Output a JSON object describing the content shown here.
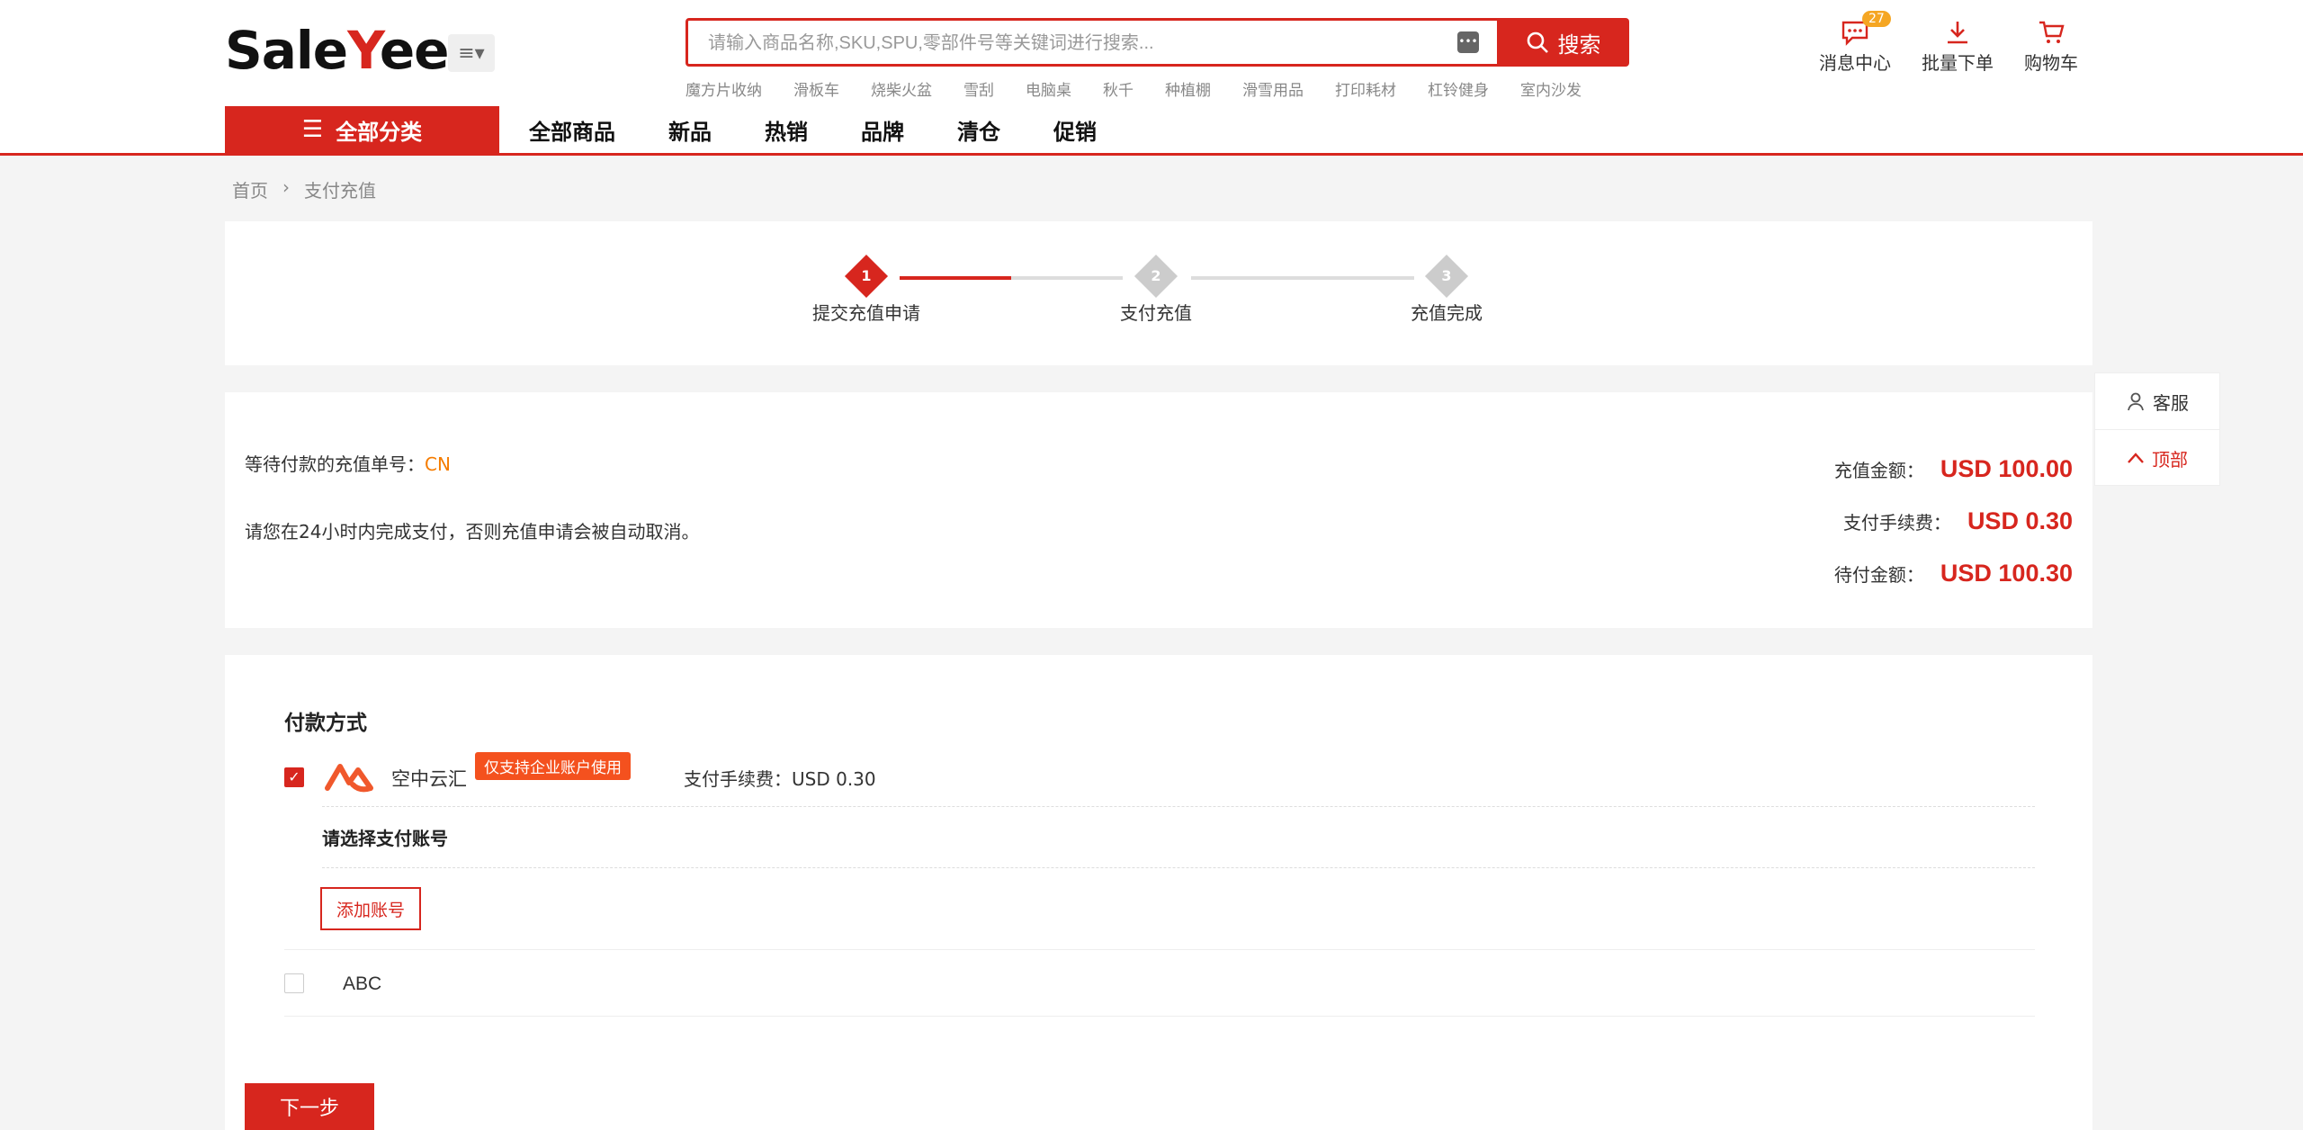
{
  "brand": {
    "logo_part1": "Sale",
    "logo_part2": "Y",
    "logo_part3": "ee",
    "accent_color": "#d7261e"
  },
  "search": {
    "placeholder": "请输入商品名称,SKU,SPU,零部件号等关键词进行搜索...",
    "button_label": "搜索",
    "hot_words": [
      "魔方片收纳",
      "滑板车",
      "烧柴火盆",
      "雪刮",
      "电脑桌",
      "秋千",
      "种植棚",
      "滑雪用品",
      "打印耗材",
      "杠铃健身",
      "室内沙发"
    ]
  },
  "top_icons": {
    "messages": {
      "label": "消息中心",
      "badge": "27"
    },
    "bulk_order": {
      "label": "批量下单"
    },
    "cart": {
      "label": "购物车"
    }
  },
  "nav": {
    "all_categories": "全部分类",
    "links": [
      "全部商品",
      "新品",
      "热销",
      "品牌",
      "清仓",
      "促销"
    ]
  },
  "breadcrumb": {
    "home": "首页",
    "separator": "›",
    "current": "支付充值"
  },
  "steps": [
    {
      "num": "1",
      "label": "提交充值申请",
      "state": "active"
    },
    {
      "num": "2",
      "label": "支付充值",
      "state": "inactive"
    },
    {
      "num": "3",
      "label": "充值完成",
      "state": "inactive"
    }
  ],
  "order": {
    "pending_label": "等待付款的充值单号：",
    "order_no": "CN",
    "notice": "请您在24小时内完成支付，否则充值申请会被自动取消。",
    "recharge_label": "充值金额：",
    "recharge_amount": "USD 100.00",
    "fee_label": "支付手续费：",
    "fee_amount": "USD 0.30",
    "due_label": "待付金额：",
    "due_amount": "USD 100.30"
  },
  "float_panel": {
    "service": "客服",
    "top": "顶部"
  },
  "payment": {
    "title": "付款方式",
    "method_name": "空中云汇",
    "method_tag": "仅支持企业账户使用",
    "method_fee": "支付手续费：USD 0.30",
    "select_account": "请选择支付账号",
    "add_account": "添加账号",
    "other_method": "ABC",
    "next": "下一步"
  }
}
